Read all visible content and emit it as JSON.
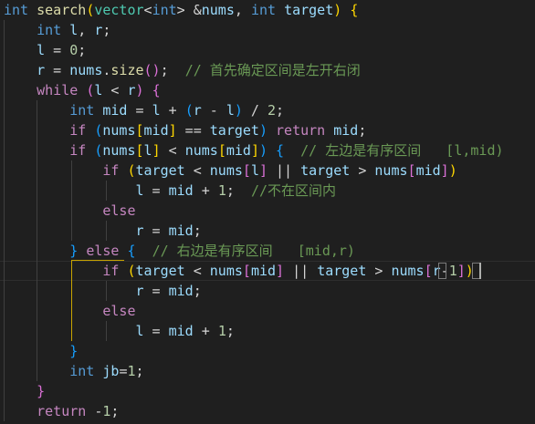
{
  "editor": {
    "language": "cpp",
    "theme_colors": {
      "background": "#1f1f1f",
      "keyword": "#569cd6",
      "control": "#c586c0",
      "function": "#dcdcaa",
      "type": "#4ec9b0",
      "variable": "#9cdcfe",
      "number": "#b5cea8",
      "comment": "#6a9955",
      "bracket_level1": "#ffd700",
      "bracket_level2": "#da70d6",
      "bracket_level3": "#179fff"
    },
    "lines": [
      [
        [
          "kw",
          "int"
        ],
        [
          "op",
          " "
        ],
        [
          "fn",
          "search"
        ],
        [
          "b1",
          "("
        ],
        [
          "ty",
          "vector"
        ],
        [
          "op",
          "<"
        ],
        [
          "kw",
          "int"
        ],
        [
          "op",
          "> &"
        ],
        [
          "var",
          "nums"
        ],
        [
          "op",
          ", "
        ],
        [
          "kw",
          "int"
        ],
        [
          "op",
          " "
        ],
        [
          "var",
          "target"
        ],
        [
          "b1",
          ")"
        ],
        [
          "op",
          " "
        ],
        [
          "b1",
          "{"
        ]
      ],
      [
        [
          "op",
          "    "
        ],
        [
          "kw",
          "int"
        ],
        [
          "op",
          " "
        ],
        [
          "var",
          "l"
        ],
        [
          "op",
          ", "
        ],
        [
          "var",
          "r"
        ],
        [
          "op",
          ";"
        ]
      ],
      [
        [
          "op",
          "    "
        ],
        [
          "var",
          "l"
        ],
        [
          "op",
          " = "
        ],
        [
          "num",
          "0"
        ],
        [
          "op",
          ";"
        ]
      ],
      [
        [
          "op",
          "    "
        ],
        [
          "var",
          "r"
        ],
        [
          "op",
          " = "
        ],
        [
          "var",
          "nums"
        ],
        [
          "op",
          "."
        ],
        [
          "fn",
          "size"
        ],
        [
          "b2",
          "()"
        ],
        [
          "op",
          ";  "
        ],
        [
          "cm",
          "// 首先确定区间是左开右闭"
        ]
      ],
      [
        [
          "op",
          "    "
        ],
        [
          "ctl",
          "while"
        ],
        [
          "op",
          " "
        ],
        [
          "b2",
          "("
        ],
        [
          "var",
          "l"
        ],
        [
          "op",
          " < "
        ],
        [
          "var",
          "r"
        ],
        [
          "b2",
          ")"
        ],
        [
          "op",
          " "
        ],
        [
          "b2",
          "{"
        ]
      ],
      [
        [
          "op",
          "        "
        ],
        [
          "kw",
          "int"
        ],
        [
          "op",
          " "
        ],
        [
          "var",
          "mid"
        ],
        [
          "op",
          " = "
        ],
        [
          "var",
          "l"
        ],
        [
          "op",
          " + "
        ],
        [
          "b3",
          "("
        ],
        [
          "var",
          "r"
        ],
        [
          "op",
          " - "
        ],
        [
          "var",
          "l"
        ],
        [
          "b3",
          ")"
        ],
        [
          "op",
          " / "
        ],
        [
          "num",
          "2"
        ],
        [
          "op",
          ";"
        ]
      ],
      [
        [
          "op",
          "        "
        ],
        [
          "ctl",
          "if"
        ],
        [
          "op",
          " "
        ],
        [
          "b3",
          "("
        ],
        [
          "var",
          "nums"
        ],
        [
          "b1",
          "["
        ],
        [
          "var",
          "mid"
        ],
        [
          "b1",
          "]"
        ],
        [
          "op",
          " == "
        ],
        [
          "var",
          "target"
        ],
        [
          "b3",
          ")"
        ],
        [
          "op",
          " "
        ],
        [
          "ctl",
          "return"
        ],
        [
          "op",
          " "
        ],
        [
          "var",
          "mid"
        ],
        [
          "op",
          ";"
        ]
      ],
      [
        [
          "op",
          "        "
        ],
        [
          "ctl",
          "if"
        ],
        [
          "op",
          " "
        ],
        [
          "b3",
          "("
        ],
        [
          "var",
          "nums"
        ],
        [
          "b1",
          "["
        ],
        [
          "var",
          "l"
        ],
        [
          "b1",
          "]"
        ],
        [
          "op",
          " < "
        ],
        [
          "var",
          "nums"
        ],
        [
          "b1",
          "["
        ],
        [
          "var",
          "mid"
        ],
        [
          "b1",
          "]"
        ],
        [
          "b3",
          ")"
        ],
        [
          "op",
          " "
        ],
        [
          "b3",
          "{"
        ],
        [
          "op",
          "  "
        ],
        [
          "cm",
          "// 左边是有序区间   [l,mid)"
        ]
      ],
      [
        [
          "op",
          "            "
        ],
        [
          "ctl",
          "if"
        ],
        [
          "op",
          " "
        ],
        [
          "b1",
          "("
        ],
        [
          "var",
          "target"
        ],
        [
          "op",
          " < "
        ],
        [
          "var",
          "nums"
        ],
        [
          "b2",
          "["
        ],
        [
          "var",
          "l"
        ],
        [
          "b2",
          "]"
        ],
        [
          "op",
          " || "
        ],
        [
          "var",
          "target"
        ],
        [
          "op",
          " > "
        ],
        [
          "var",
          "nums"
        ],
        [
          "b2",
          "["
        ],
        [
          "var",
          "mid"
        ],
        [
          "b2",
          "]"
        ],
        [
          "b1",
          ")"
        ]
      ],
      [
        [
          "op",
          "                "
        ],
        [
          "var",
          "l"
        ],
        [
          "op",
          " = "
        ],
        [
          "var",
          "mid"
        ],
        [
          "op",
          " + "
        ],
        [
          "num",
          "1"
        ],
        [
          "op",
          ";  "
        ],
        [
          "cm",
          "//不在区间内"
        ]
      ],
      [
        [
          "op",
          "            "
        ],
        [
          "ctl",
          "else"
        ]
      ],
      [
        [
          "op",
          "                "
        ],
        [
          "var",
          "r"
        ],
        [
          "op",
          " = "
        ],
        [
          "var",
          "mid"
        ],
        [
          "op",
          ";"
        ]
      ],
      [
        [
          "op",
          "        "
        ],
        [
          "b3",
          "}"
        ],
        [
          "op",
          " "
        ],
        [
          "ctl",
          "else"
        ],
        [
          "op",
          " "
        ],
        [
          "b3",
          "{"
        ],
        [
          "op",
          "  "
        ],
        [
          "cm",
          "// 右边是有序区间   [mid,r)"
        ]
      ],
      [
        [
          "op",
          "            "
        ],
        [
          "ctl",
          "if"
        ],
        [
          "op",
          " "
        ],
        [
          "b1",
          "("
        ],
        [
          "var",
          "target"
        ],
        [
          "op",
          " < "
        ],
        [
          "var",
          "nums"
        ],
        [
          "b2",
          "["
        ],
        [
          "var",
          "mid"
        ],
        [
          "b2",
          "]"
        ],
        [
          "op",
          " || "
        ],
        [
          "var",
          "target"
        ],
        [
          "op",
          " > "
        ],
        [
          "var",
          "nums"
        ],
        [
          "b2",
          "["
        ],
        [
          "var",
          "r"
        ],
        [
          "op",
          "-"
        ],
        [
          "num",
          "1"
        ],
        [
          "b2",
          "]"
        ],
        [
          "b1",
          ")"
        ]
      ],
      [
        [
          "op",
          "                "
        ],
        [
          "var",
          "r"
        ],
        [
          "op",
          " = "
        ],
        [
          "var",
          "mid"
        ],
        [
          "op",
          ";"
        ]
      ],
      [
        [
          "op",
          "            "
        ],
        [
          "ctl",
          "else"
        ]
      ],
      [
        [
          "op",
          "                "
        ],
        [
          "var",
          "l"
        ],
        [
          "op",
          " = "
        ],
        [
          "var",
          "mid"
        ],
        [
          "op",
          " + "
        ],
        [
          "num",
          "1"
        ],
        [
          "op",
          ";"
        ]
      ],
      [
        [
          "op",
          "        "
        ],
        [
          "b3",
          "}"
        ]
      ],
      [
        [
          "op",
          "        "
        ],
        [
          "kw",
          "int"
        ],
        [
          "op",
          " "
        ],
        [
          "var",
          "jb"
        ],
        [
          "op",
          "="
        ],
        [
          "num",
          "1"
        ],
        [
          "op",
          ";"
        ]
      ],
      [
        [
          "op",
          "    "
        ],
        [
          "b2",
          "}"
        ]
      ],
      [
        [
          "op",
          "    "
        ],
        [
          "ctl",
          "return"
        ],
        [
          "op",
          " -"
        ],
        [
          "num",
          "1"
        ],
        [
          "op",
          ";"
        ]
      ]
    ]
  }
}
